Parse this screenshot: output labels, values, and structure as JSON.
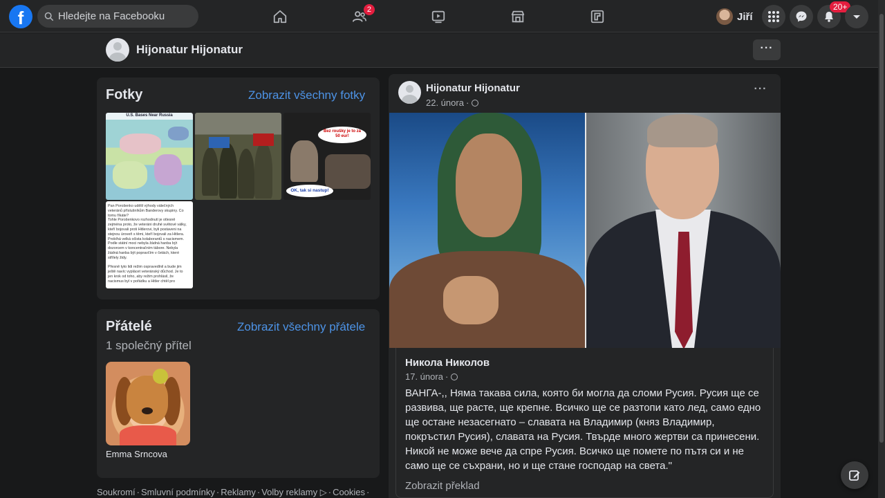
{
  "topbar": {
    "logo": "f",
    "search_placeholder": "Hledejte na Facebooku",
    "friends_badge": "2",
    "user_name": "Jiří",
    "notifications_badge": "20+"
  },
  "profile_strip": {
    "name": "Hijonatur Hijonatur",
    "more": "···"
  },
  "photos_card": {
    "title": "Fotky",
    "link": "Zobrazit všechny fotky",
    "map_caption": "U.S. Bases Near Russia",
    "meme_bubble_top": "Bez roušky je to za 50 eur!",
    "meme_bubble_bottom": "OK, tak si nastup!",
    "text_photo": "Pan Porošenko udělil výhody válečných\nveteránů příslušníkům Banderovy skupiny. Co\ntomu říkáte?\nTohle Porošenkovo rozhodnutí je otlesně\nzejména proto, že veteráni druhé světové války,\nkteří bojovali proti Hitlerovi, byli postaveni na\nstejnou úroveň s těmi, kteří bojovali za Hitlera.\nProbíhá velká očista kolaborantů s nacismem.\nPodle státní moci nebyla žádná hanba být\ndozorcem v koncentračním tábore. Nebyla\nžádná hanba být popravčím v četách, které\nstřílely židy.\n\nPřesně tyto lidi režim ospravedlnil a bude jim\nještě navíc vyplácet veteránský důchod. Je to\njen krok od toho, aby režim prohlásil, že\nnacismus byl v pořádku a Hitler chtěl pro"
  },
  "friends_card": {
    "title": "Přátelé",
    "link": "Zobrazit všechny přátele",
    "mutual": "1 společný přítel",
    "friend_name": "Emma Srncova"
  },
  "footer": {
    "links": [
      "Soukromí",
      "Smluvní podmínky",
      "Reklamy",
      "Volby reklamy ▷",
      "Cookies"
    ]
  },
  "post": {
    "author": "Hijonatur Hijonatur",
    "date": "22. února",
    "more": "···",
    "shared": {
      "author": "Никола Николов",
      "date": "17. února",
      "text": "ВАНГА-,, Няма такава сила, която би могла да сломи Русия. Русия ще се развива, ще расте, ще крепне. Всичко ще се разтопи като лед, само едно ще остане незасегнато – славата на Владимир (княз Владимир, покръстил Русия), славата на Русия. Твърде много жертви са принесени. Никой не може вече да спре Русия. Всичко ще помете по пътя си и не само ще се съхрани, но и ще стане господар на света.\"",
      "translate": "Zobrazit překlad"
    }
  },
  "colors": {
    "bg": "#18191a",
    "surface": "#242526",
    "accent": "#1877f2",
    "link": "#4d93e6",
    "badge": "#e41e3f"
  }
}
